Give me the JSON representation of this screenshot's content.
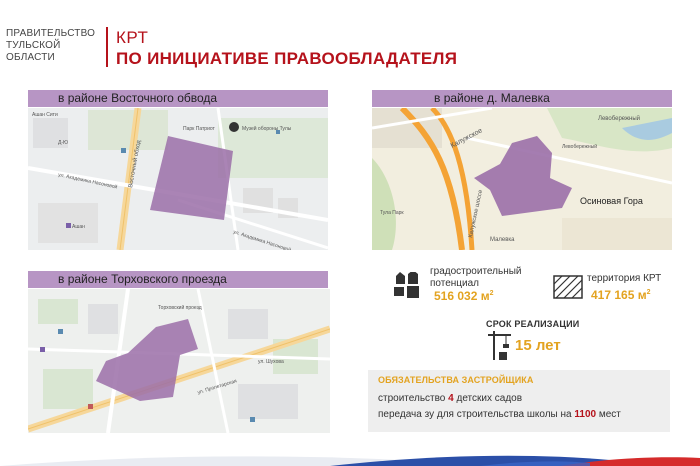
{
  "header": {
    "org_line1": "ПРАВИТЕЛЬСТВО",
    "org_line2": "ТУЛЬСКОЙ",
    "org_line3": "ОБЛАСТИ",
    "title_line1": "КРТ",
    "title_line2": "ПО ИНИЦИАТИВЕ ПРАВООБЛАДАТЕЛЯ"
  },
  "maps": {
    "vostochny": {
      "label": "в районе Восточного обвода",
      "streets": [
        "Восточный обход",
        "ул. Академика Насоновой",
        "ул. Академика Насоновой"
      ],
      "places": [
        "Парк Патриот",
        "Музей обороны Тулы",
        "Ашан",
        "Ашан Сити",
        "Д-Ю"
      ]
    },
    "malevka": {
      "label": "в районе д. Малевка",
      "streets": [
        "Калужское",
        "Калужское шоссе"
      ],
      "places": [
        "Осиновая Гора",
        "Малевка",
        "Левобережный",
        "Левобережный",
        "Тула Парк"
      ]
    },
    "torkhovsky": {
      "label": "в районе Торховского проезда",
      "streets": [
        "ул. Пролетарская",
        "Торховский проезд",
        "ул. Шухова"
      ],
      "places": []
    }
  },
  "stats": {
    "potential_label_line1": "градостроительный",
    "potential_label_line2": "потенциал",
    "potential_value": "516 032 м",
    "potential_unit_sup": "2",
    "territory_label": "территория КРТ",
    "territory_value": "417 165 м",
    "territory_unit_sup": "2",
    "term_title": "СРОК РЕАЛИЗАЦИИ",
    "term_value": "15 лет"
  },
  "obligations": {
    "title": "ОБЯЗАТЕЛЬСТВА ЗАСТРОЙЩИКА",
    "line1_pre": "строительство ",
    "line1_num": "4",
    "line1_post": " детских садов",
    "line2_pre": "передача зу для строительства школы на ",
    "line2_num": "1100",
    "line2_post": " мест"
  },
  "colors": {
    "brand_red": "#b5121b",
    "accent_orange": "#e3a320",
    "label_purple": "#b795c4",
    "zone_purple": "#9b6fa8"
  }
}
